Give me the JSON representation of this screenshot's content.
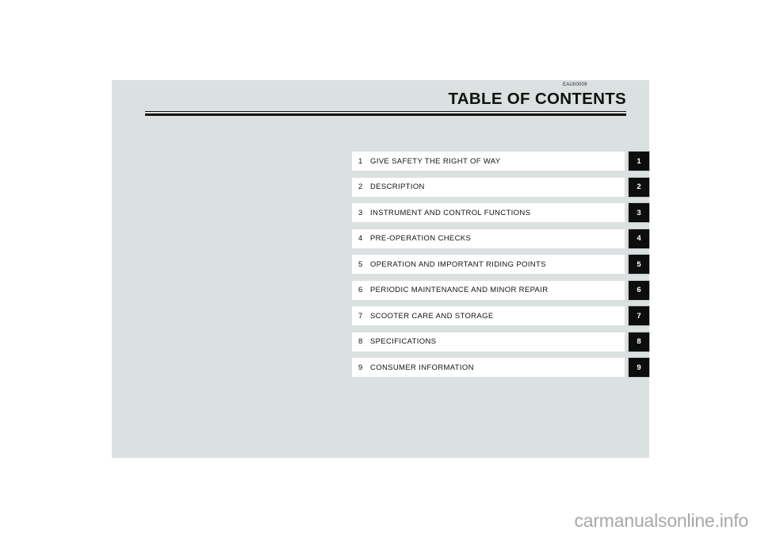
{
  "document": {
    "code": "EAU00009",
    "title": "TABLE OF CONTENTS"
  },
  "contents": {
    "rows": [
      {
        "number": "1",
        "label": "GIVE SAFETY THE RIGHT OF WAY",
        "tab": "1"
      },
      {
        "number": "2",
        "label": "DESCRIPTION",
        "tab": "2"
      },
      {
        "number": "3",
        "label": "INSTRUMENT AND CONTROL FUNCTIONS",
        "tab": "3"
      },
      {
        "number": "4",
        "label": "PRE-OPERATION CHECKS",
        "tab": "4"
      },
      {
        "number": "5",
        "label": "OPERATION AND IMPORTANT RIDING POINTS",
        "tab": "5"
      },
      {
        "number": "6",
        "label": "PERIODIC MAINTENANCE AND MINOR REPAIR",
        "tab": "6"
      },
      {
        "number": "7",
        "label": "SCOOTER CARE AND STORAGE",
        "tab": "7"
      },
      {
        "number": "8",
        "label": "SPECIFICATIONS",
        "tab": "8"
      },
      {
        "number": "9",
        "label": "CONSUMER INFORMATION",
        "tab": "9"
      }
    ]
  },
  "watermark": {
    "text": "carmanualsonline.info"
  },
  "colors": {
    "page_background": "#dbe0e0",
    "row_background": "#ffffff",
    "tab_background": "#0d0d0d",
    "text": "#111111",
    "watermark": "#a8a8a8"
  }
}
